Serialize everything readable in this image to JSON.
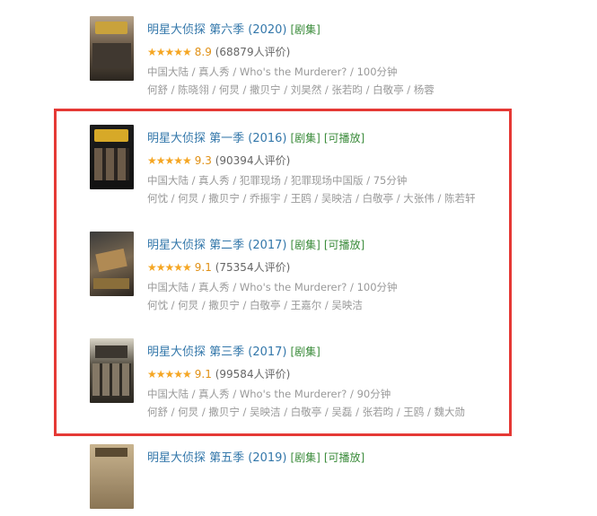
{
  "items": [
    {
      "title": "明星大侦探 第六季 (2020)",
      "tags": [
        "[剧集]"
      ],
      "score": "8.9",
      "votes": "(68879人评价)",
      "meta": "中国大陆 / 真人秀 / Who's the Murderer? / 100分钟",
      "cast": "何舒 / 陈晓翎 / 何炅 / 撒贝宁 / 刘昊然 / 张若昀 / 白敬亭 / 杨蓉",
      "stars": 4.5
    },
    {
      "title": "明星大侦探 第一季 (2016)",
      "tags": [
        "[剧集]",
        "[可播放]"
      ],
      "score": "9.3",
      "votes": "(90394人评价)",
      "meta": "中国大陆 / 真人秀 / 犯罪现场 / 犯罪现场中国版 / 75分钟",
      "cast": "何忱 / 何炅 / 撒贝宁 / 乔振宇 / 王鸥 / 吴映洁 / 白敬亭 / 大张伟 / 陈若轩",
      "stars": 4.5
    },
    {
      "title": "明星大侦探 第二季 (2017)",
      "tags": [
        "[剧集]",
        "[可播放]"
      ],
      "score": "9.1",
      "votes": "(75354人评价)",
      "meta": "中国大陆 / 真人秀 / Who's the Murderer? / 100分钟",
      "cast": "何忱 / 何炅 / 撒贝宁 / 白敬亭 / 王嘉尔 / 吴映洁",
      "stars": 4.5
    },
    {
      "title": "明星大侦探 第三季 (2017)",
      "tags": [
        "[剧集]"
      ],
      "score": "9.1",
      "votes": "(99584人评价)",
      "meta": "中国大陆 / 真人秀 / Who's the Murderer? / 90分钟",
      "cast": "何舒 / 何炅 / 撒贝宁 / 吴映洁 / 白敬亭 / 吴磊 / 张若昀 / 王鸥 / 魏大勋",
      "stars": 4.5
    },
    {
      "title": "明星大侦探 第五季 (2019)",
      "tags": [
        "[剧集]",
        "[可播放]"
      ],
      "score": "",
      "votes": "",
      "meta": "",
      "cast": "",
      "stars": 0
    }
  ],
  "colors": {
    "title": "#3377aa",
    "tag": "#3a8b3a",
    "star": "#f5a623",
    "highlight": "#e53935"
  }
}
